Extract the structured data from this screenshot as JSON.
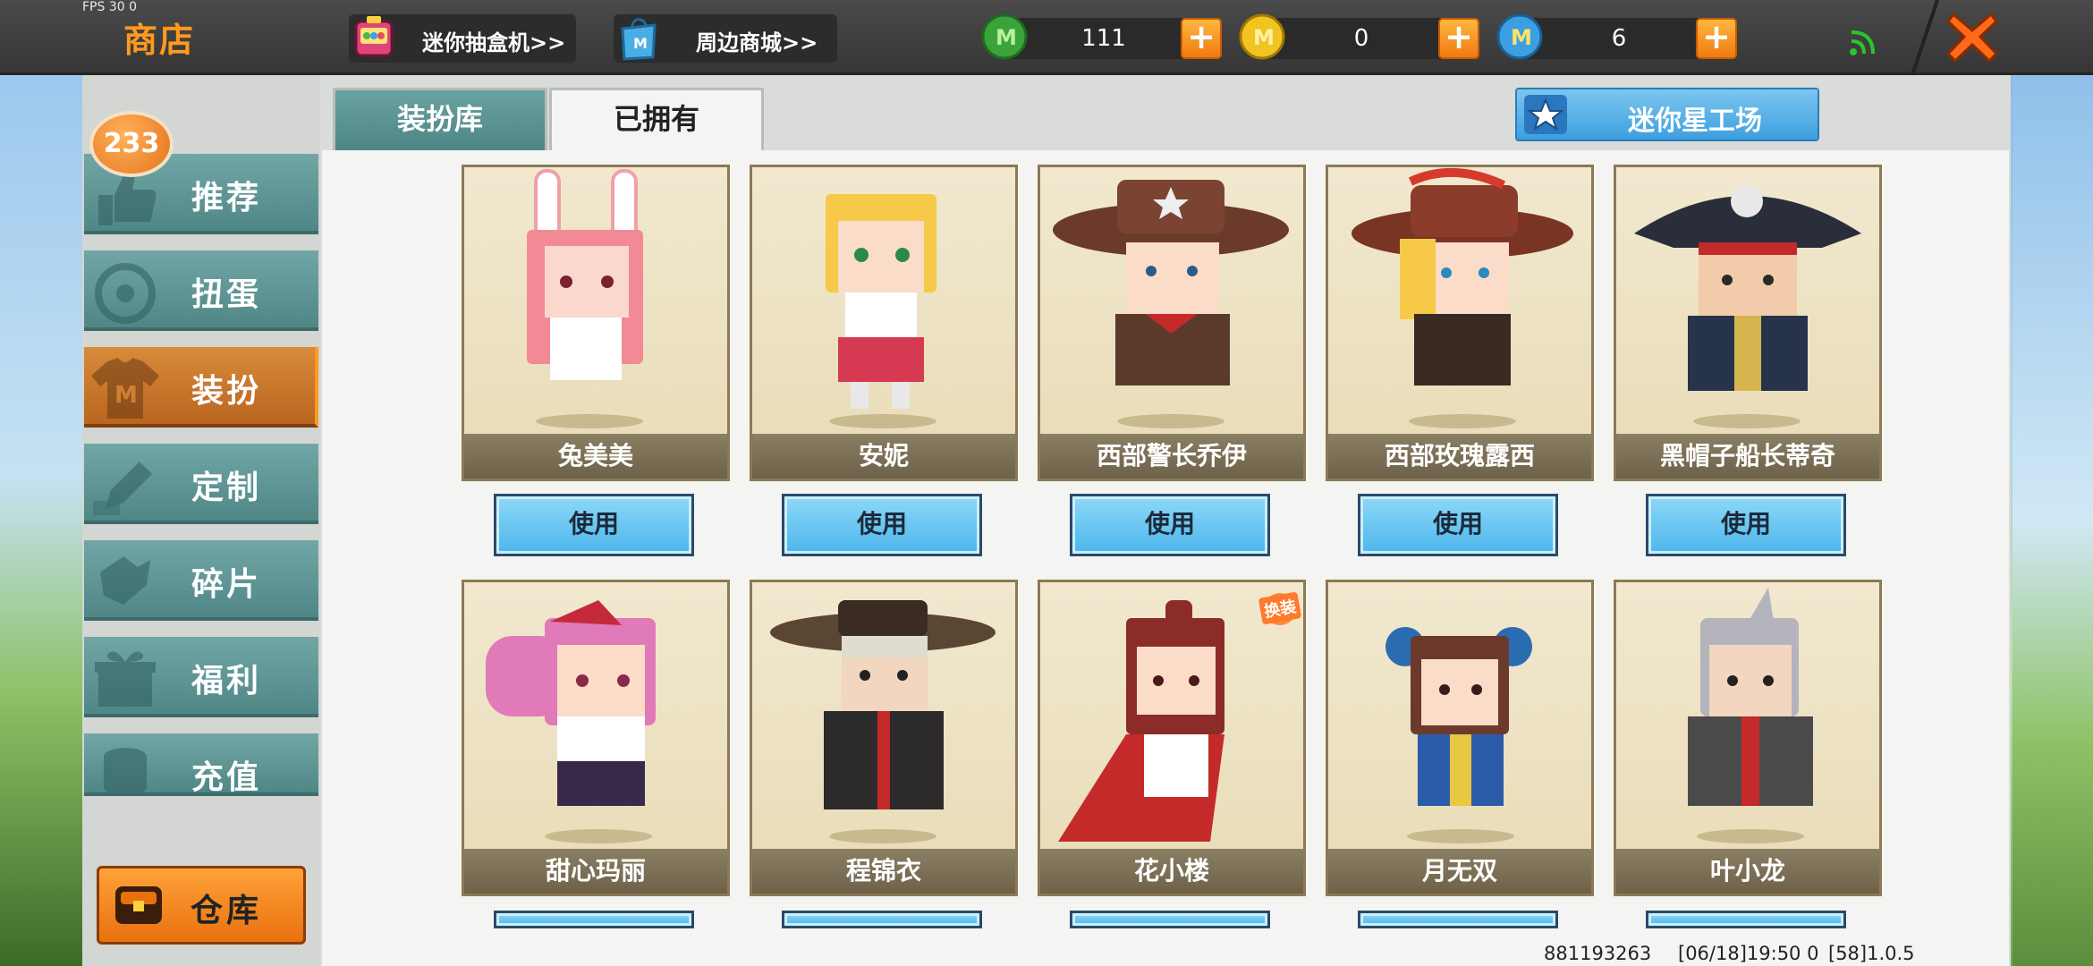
{
  "topbar": {
    "fps": "FPS 30 0",
    "title": "商店",
    "links": [
      {
        "label": "迷你抽盒机>>",
        "icon": "capsule-machine-icon"
      },
      {
        "label": "周边商城>>",
        "icon": "shopping-bag-icon"
      }
    ],
    "currencies": [
      {
        "value": "111",
        "icon": "green-gem-icon",
        "color": "#3aa43a"
      },
      {
        "value": "0",
        "icon": "gold-coin-icon",
        "color": "#f2c420"
      },
      {
        "value": "6",
        "icon": "blue-mini-coin-icon",
        "color": "#3c9fe0"
      }
    ]
  },
  "sidebar": {
    "badge": "233",
    "items": [
      {
        "label": "推荐",
        "icon": "thumbs-up-icon"
      },
      {
        "label": "扭蛋",
        "icon": "capsule-icon"
      },
      {
        "label": "装扮",
        "icon": "tshirt-icon",
        "active": true
      },
      {
        "label": "定制",
        "icon": "pencil-icon"
      },
      {
        "label": "碎片",
        "icon": "fragment-icon"
      },
      {
        "label": "福利",
        "icon": "gift-icon"
      },
      {
        "label": "充值",
        "icon": "coins-icon"
      }
    ],
    "warehouse": "仓库"
  },
  "tabs": {
    "wardrobe": "装扮库",
    "owned": "已拥有"
  },
  "workshop": {
    "label": "迷你星工场"
  },
  "skins": {
    "row1": [
      {
        "name": "兔美美",
        "button": "使用"
      },
      {
        "name": "安妮",
        "button": "使用"
      },
      {
        "name": "西部警长乔伊",
        "button": "使用"
      },
      {
        "name": "西部玫瑰露西",
        "button": "使用"
      },
      {
        "name": "黑帽子船长蒂奇",
        "button": "使用"
      }
    ],
    "row2": [
      {
        "name": "甜心玛丽"
      },
      {
        "name": "程锦衣"
      },
      {
        "name": "花小楼",
        "tag": "换装"
      },
      {
        "name": "月无双"
      },
      {
        "name": "叶小龙"
      }
    ]
  },
  "status": {
    "id": "881193263",
    "time": "[06/18]19:50 0",
    "version": "[58]1.0.5"
  }
}
